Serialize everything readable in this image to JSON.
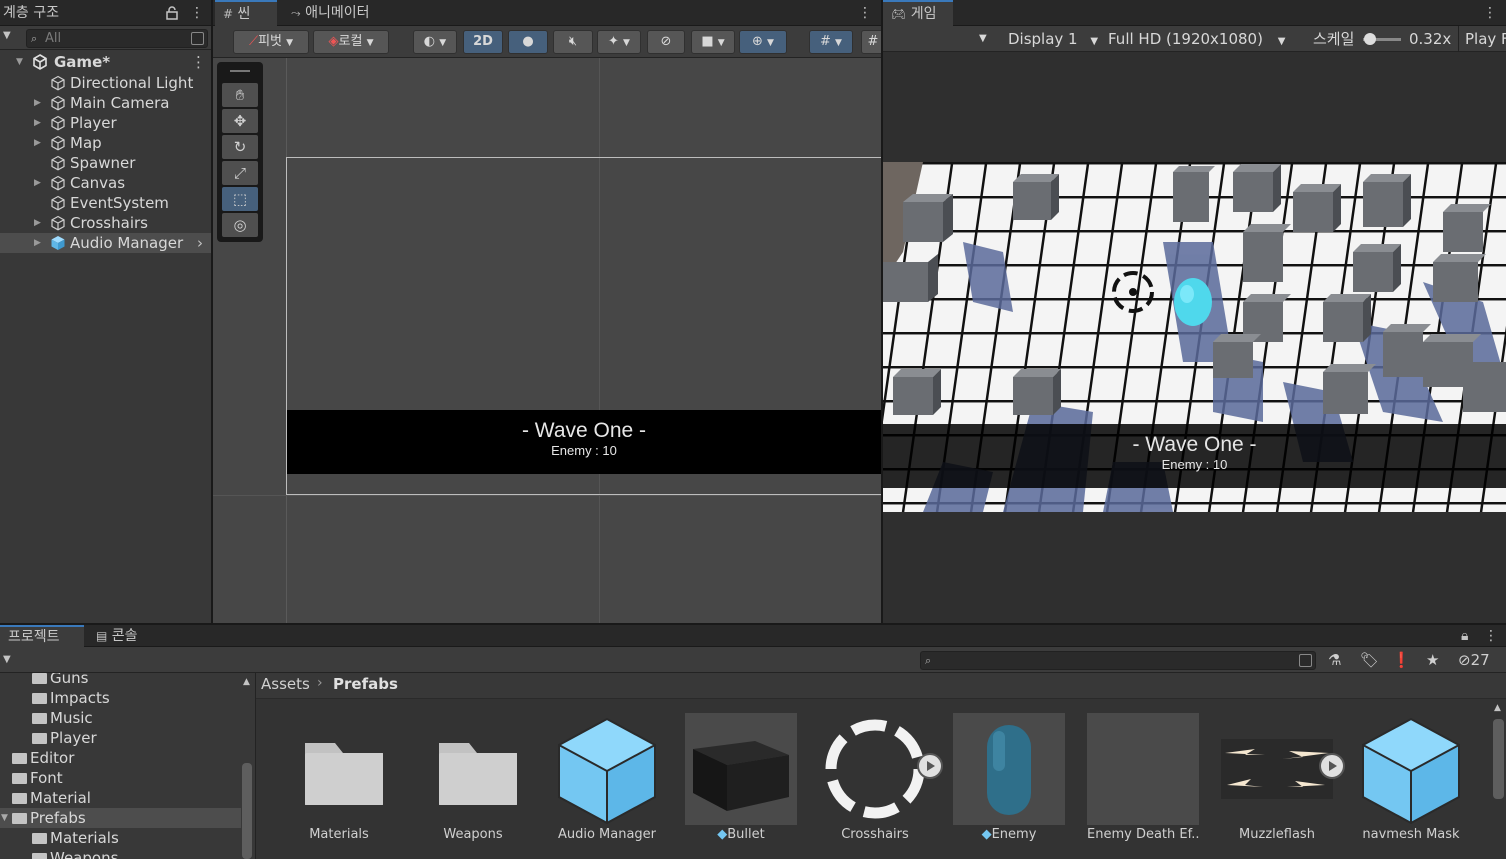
{
  "hierarchy": {
    "tab_label": "계층 구조",
    "search_placeholder": "All",
    "scene_name": "Game*",
    "items": [
      {
        "label": "Directional Light",
        "expandable": false
      },
      {
        "label": "Main Camera",
        "expandable": true
      },
      {
        "label": "Player",
        "expandable": true
      },
      {
        "label": "Map",
        "expandable": true
      },
      {
        "label": "Spawner",
        "expandable": false
      },
      {
        "label": "Canvas",
        "expandable": true
      },
      {
        "label": "EventSystem",
        "expandable": false
      },
      {
        "label": "Crosshairs",
        "expandable": true
      },
      {
        "label": "Audio Manager",
        "expandable": true,
        "selected": true,
        "prefab": true
      }
    ]
  },
  "scene": {
    "tab_label": "씬",
    "animator_tab_label": "애니메이터",
    "pivot_label": "피벗",
    "local_label": "로컬",
    "mode_2d_label": "2D",
    "wave_title": "- Wave One -",
    "enemy_text": "Enemy : 10"
  },
  "game": {
    "tab_label": "게임",
    "display_label": "Display 1",
    "resolution_label": "Full HD (1920x1080)",
    "scale_label": "스케일",
    "scale_value": "0.32x",
    "play_label": "Play F",
    "wave_title": "- Wave One -",
    "enemy_text": "Enemy : 10"
  },
  "project": {
    "tab_label": "프로젝트",
    "console_tab_label": "콘솔",
    "hidden_count": "27",
    "breadcrumb_root": "Assets",
    "breadcrumb_current": "Prefabs",
    "folders": [
      {
        "label": "Guns",
        "indent": 1
      },
      {
        "label": "Impacts",
        "indent": 1
      },
      {
        "label": "Music",
        "indent": 1
      },
      {
        "label": "Player",
        "indent": 1
      },
      {
        "label": "Editor",
        "indent": 0
      },
      {
        "label": "Font",
        "indent": 0
      },
      {
        "label": "Material",
        "indent": 0
      },
      {
        "label": "Prefabs",
        "indent": 0,
        "selected": true
      },
      {
        "label": "Materials",
        "indent": 1
      },
      {
        "label": "Weapons",
        "indent": 1
      }
    ],
    "assets": [
      {
        "label": "Materials",
        "kind": "folder"
      },
      {
        "label": "Weapons",
        "kind": "folder"
      },
      {
        "label": "Audio Manager",
        "kind": "prefab-cube"
      },
      {
        "label": "Bullet",
        "kind": "black-box"
      },
      {
        "label": "Crosshairs",
        "kind": "ring"
      },
      {
        "label": "Enemy",
        "kind": "capsule"
      },
      {
        "label": "Enemy Death Ef...",
        "kind": "empty"
      },
      {
        "label": "Muzzleflash",
        "kind": "flash"
      },
      {
        "label": "navmesh Mask",
        "kind": "prefab-cube"
      }
    ]
  },
  "colors": {
    "accent": "#3a79bb",
    "prefab_blue": "#74c7f2",
    "panel_bg": "#383838",
    "scene_bg": "#474747"
  }
}
